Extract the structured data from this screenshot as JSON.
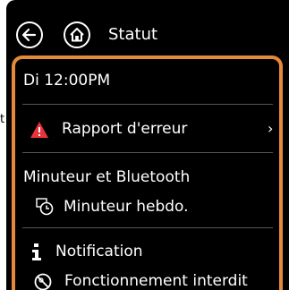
{
  "header": {
    "title": "Statut",
    "back_icon": "back-arrow-icon",
    "home_icon": "home-icon"
  },
  "panel": {
    "accent_color": "#e5893a",
    "datetime": "Di 12:00PM",
    "error_row": {
      "label": "Rapport d'erreur",
      "icon": "warning-triangle-icon",
      "icon_color": "#e8323c",
      "chevron": "›"
    },
    "timer_section": {
      "title": "Minuteur et Bluetooth",
      "weekly_timer_label": "Minuteur hebdo.",
      "weekly_timer_icon": "weekly-timer-icon"
    },
    "notification": {
      "label": "Notification",
      "icon": "info-icon",
      "forbidden_label": "Fonctionnement interdit",
      "forbidden_icon": "prohibited-icon"
    }
  }
}
